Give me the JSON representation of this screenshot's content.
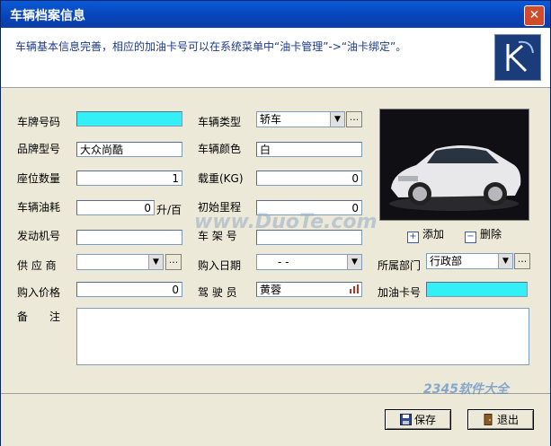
{
  "window": {
    "title": "车辆档案信息",
    "close": "✕"
  },
  "banner": {
    "text": "车辆基本信息完善，相应的加油卡号可以在系统菜单中“油卡管理”->“油卡绑定”。"
  },
  "form": {
    "plate_label": "车牌号码",
    "plate_value": "",
    "model_label": "品牌型号",
    "model_value": "大众尚酷",
    "seats_label": "座位数量",
    "seats_value": "1",
    "fuel_label": "车辆油耗",
    "fuel_value": "0",
    "fuel_unit": "升/百",
    "engine_label": "发动机号",
    "engine_value": "",
    "supplier_label": "供 应 商",
    "supplier_value": "",
    "price_label": "购入价格",
    "price_value": "0",
    "type_label": "车辆类型",
    "type_value": "轿车",
    "color_label": "车辆颜色",
    "color_value": "白",
    "load_label": "载重(KG)",
    "load_value": "0",
    "mileage_label": "初始里程",
    "mileage_value": "0",
    "frame_label": "车 架 号",
    "frame_value": "",
    "purchase_date_label": "购入日期",
    "purchase_date_value": "-  -",
    "driver_label": "驾 驶 员",
    "driver_value": "黄蓉",
    "dept_label": "所属部门",
    "dept_value": "行政部",
    "card_label": "加油卡号",
    "card_value": "",
    "notes_label": "备　　注",
    "ellipsis": "...",
    "arrow": "▼"
  },
  "photo": {
    "add_label": "添加",
    "delete_label": "删除",
    "add_icon": "+",
    "delete_icon": "−"
  },
  "buttons": {
    "save": "保存",
    "exit": "退出"
  },
  "watermarks": {
    "duote": "www.DuoTe.com",
    "site": "2345软件大全"
  },
  "colors": {
    "title_bar": "#0A4BC8",
    "cyan_field": "#33F0F7",
    "banner_text": "#1A3A8A"
  }
}
